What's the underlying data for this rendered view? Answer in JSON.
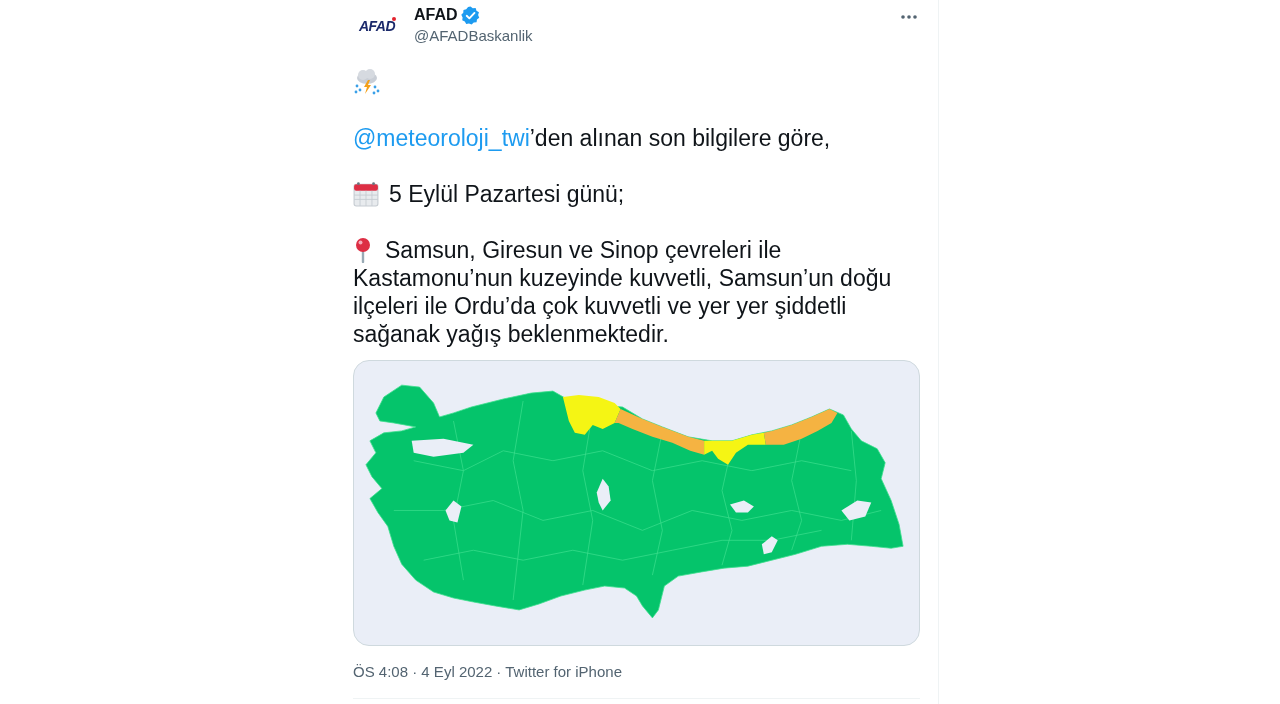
{
  "author": {
    "avatar_text": "AFAD",
    "name": "AFAD",
    "verified": true,
    "handle": "@AFADBaskanlik"
  },
  "paragraphs": [
    {
      "kind": "weather"
    },
    {
      "kind": "mention",
      "mention": "@meteoroloji_twi",
      "text": "’den alınan son bilgilere göre,"
    },
    {
      "kind": "calendar",
      "text": "5 Eylül Pazartesi günü;"
    },
    {
      "kind": "pin",
      "text": "Samsun, Giresun ve Sinop çevreleri ile",
      "continuation": "Kastamonu’nun kuzeyinde kuvvetli, Samsun’un doğu ilçeleri ile Ordu’da çok kuvvetli ve yer yer şiddetli sağanak yağış beklenmektedir."
    }
  ],
  "footer": {
    "timestamp": "ÖS 4:08 · 4 Eyl 2022",
    "separator": "·",
    "source": "Twitter for iPhone"
  }
}
